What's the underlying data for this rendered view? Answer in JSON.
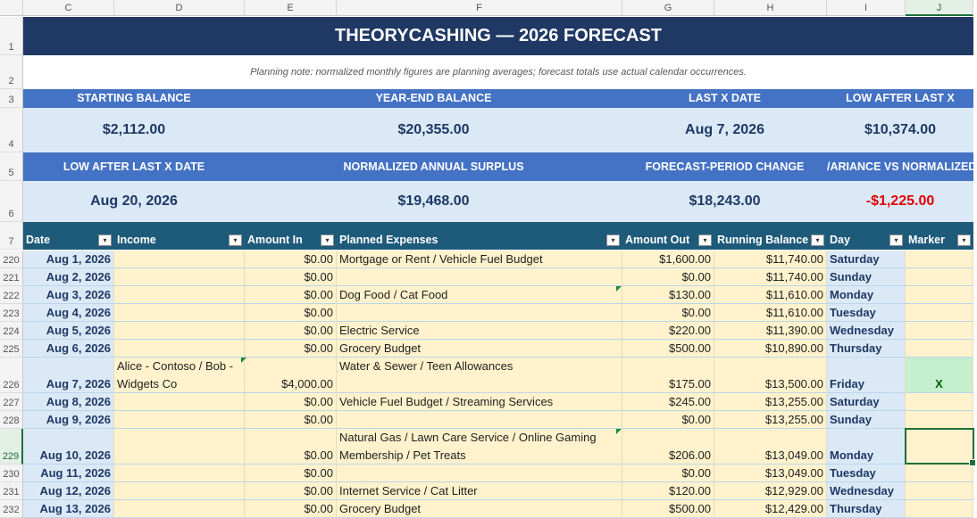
{
  "column_headers": [
    "C",
    "D",
    "E",
    "F",
    "G",
    "H",
    "I",
    "J"
  ],
  "row_headers_top": [
    "1",
    "2",
    "3",
    "4",
    "5",
    "6",
    "7"
  ],
  "title": "THEORYCASHING — 2026 FORECAST",
  "note": "Planning note: normalized monthly figures are planning averages; forecast totals use actual calendar occurrences.",
  "kpis_row1": [
    {
      "label": "STARTING BALANCE",
      "value": "$2,112.00"
    },
    {
      "label": "YEAR-END BALANCE",
      "value": "$20,355.00"
    },
    {
      "label": "LAST X DATE",
      "value": "Aug 7, 2026"
    },
    {
      "label": "LOW AFTER LAST X",
      "value": "$10,374.00"
    }
  ],
  "kpis_row2": [
    {
      "label": "LOW AFTER LAST X DATE",
      "value": "Aug 20, 2026"
    },
    {
      "label": "NORMALIZED ANNUAL SURPLUS",
      "value": "$19,468.00"
    },
    {
      "label": "FORECAST-PERIOD CHANGE",
      "value": "$18,243.00"
    },
    {
      "label": "/ARIANCE VS NORMALIZED",
      "value": "-$1,225.00"
    }
  ],
  "table_headers": [
    "Date",
    "Income",
    "Amount In",
    "Planned Expenses",
    "Amount Out",
    "Running Balance",
    "Day",
    "Marker"
  ],
  "filter_icon": "▾",
  "rows": [
    {
      "row": "220",
      "date": "Aug 1, 2026",
      "income": "",
      "amount_in": "$0.00",
      "expenses": "Mortgage or Rent / Vehicle Fuel Budget",
      "amount_out": "$1,600.00",
      "balance": "$11,740.00",
      "day": "Saturday",
      "marker": ""
    },
    {
      "row": "221",
      "date": "Aug 2, 2026",
      "income": "",
      "amount_in": "$0.00",
      "expenses": "",
      "amount_out": "$0.00",
      "balance": "$11,740.00",
      "day": "Sunday",
      "marker": ""
    },
    {
      "row": "222",
      "date": "Aug 3, 2026",
      "income": "",
      "amount_in": "$0.00",
      "expenses": "Dog Food / Cat Food",
      "amount_out": "$130.00",
      "balance": "$11,610.00",
      "day": "Monday",
      "marker": ""
    },
    {
      "row": "223",
      "date": "Aug 4, 2026",
      "income": "",
      "amount_in": "$0.00",
      "expenses": "",
      "amount_out": "$0.00",
      "balance": "$11,610.00",
      "day": "Tuesday",
      "marker": ""
    },
    {
      "row": "224",
      "date": "Aug 5, 2026",
      "income": "",
      "amount_in": "$0.00",
      "expenses": "Electric Service",
      "amount_out": "$220.00",
      "balance": "$11,390.00",
      "day": "Wednesday",
      "marker": ""
    },
    {
      "row": "225",
      "date": "Aug 6, 2026",
      "income": "",
      "amount_in": "$0.00",
      "expenses": "Grocery Budget",
      "amount_out": "$500.00",
      "balance": "$10,890.00",
      "day": "Thursday",
      "marker": ""
    },
    {
      "row": "226",
      "date": "Aug 7, 2026",
      "income": "Alice - Contoso / Bob - Widgets Co",
      "amount_in": "$4,000.00",
      "expenses": "Water & Sewer / Teen Allowances",
      "amount_out": "$175.00",
      "balance": "$13,500.00",
      "day": "Friday",
      "marker": "X"
    },
    {
      "row": "227",
      "date": "Aug 8, 2026",
      "income": "",
      "amount_in": "$0.00",
      "expenses": "Vehicle Fuel Budget / Streaming Services",
      "amount_out": "$245.00",
      "balance": "$13,255.00",
      "day": "Saturday",
      "marker": ""
    },
    {
      "row": "228",
      "date": "Aug 9, 2026",
      "income": "",
      "amount_in": "$0.00",
      "expenses": "",
      "amount_out": "$0.00",
      "balance": "$13,255.00",
      "day": "Sunday",
      "marker": ""
    },
    {
      "row": "229",
      "date": "Aug 10, 2026",
      "income": "",
      "amount_in": "$0.00",
      "expenses": "Natural Gas / Lawn Care Service / Online Gaming Membership / Pet Treats",
      "amount_out": "$206.00",
      "balance": "$13,049.00",
      "day": "Monday",
      "marker": ""
    },
    {
      "row": "230",
      "date": "Aug 11, 2026",
      "income": "",
      "amount_in": "$0.00",
      "expenses": "",
      "amount_out": "$0.00",
      "balance": "$13,049.00",
      "day": "Tuesday",
      "marker": ""
    },
    {
      "row": "231",
      "date": "Aug 12, 2026",
      "income": "",
      "amount_in": "$0.00",
      "expenses": "Internet Service / Cat Litter",
      "amount_out": "$120.00",
      "balance": "$12,929.00",
      "day": "Wednesday",
      "marker": ""
    },
    {
      "row": "232",
      "date": "Aug 13, 2026",
      "income": "",
      "amount_in": "$0.00",
      "expenses": "Grocery Budget",
      "amount_out": "$500.00",
      "balance": "$12,429.00",
      "day": "Thursday",
      "marker": ""
    }
  ],
  "selected_cell": "J229"
}
